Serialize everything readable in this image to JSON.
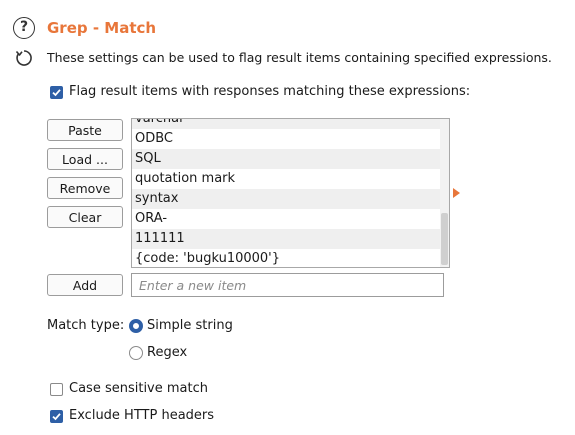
{
  "header": {
    "title": "Grep - Match",
    "description": "These settings can be used to flag result items containing specified expressions."
  },
  "flag_option": {
    "label": "Flag result items with responses matching these expressions:",
    "checked": true
  },
  "buttons": {
    "paste": "Paste",
    "load": "Load ...",
    "remove": "Remove",
    "clear": "Clear",
    "add": "Add"
  },
  "expressions": [
    "varchar",
    "ODBC",
    "SQL",
    "quotation mark",
    "syntax",
    "ORA-",
    "111111",
    "{code: 'bugku10000'}"
  ],
  "new_item": {
    "placeholder": "Enter a new item",
    "value": ""
  },
  "match_type": {
    "label": "Match type:",
    "options": [
      "Simple string",
      "Regex"
    ],
    "selected": "Simple string"
  },
  "options": {
    "case_sensitive": {
      "label": "Case sensitive match",
      "checked": false
    },
    "exclude_headers": {
      "label": "Exclude HTTP headers",
      "checked": true
    }
  },
  "colors": {
    "accent": "#e8763a",
    "checkbox": "#2e5fa6"
  }
}
